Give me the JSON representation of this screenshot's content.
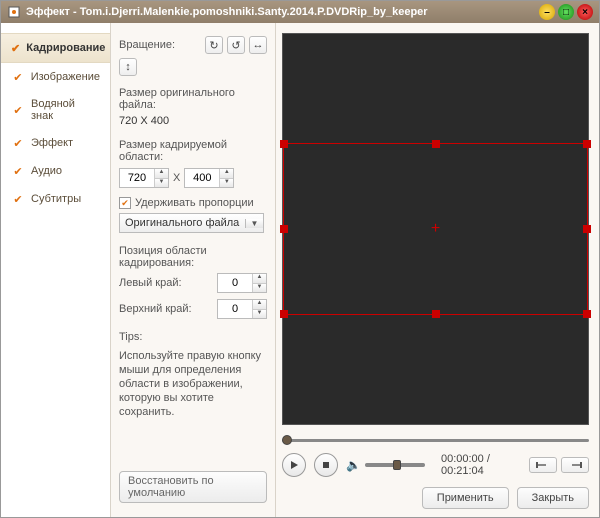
{
  "title": "Эффект - Tom.i.Djerri.Malenkie.pomoshniki.Santy.2014.P.DVDRip_by_keeper",
  "sidebar": {
    "items": [
      {
        "label": "Кадрирование",
        "active": true
      },
      {
        "label": "Изображение",
        "active": false
      },
      {
        "label": "Водяной знак",
        "active": false
      },
      {
        "label": "Эффект",
        "active": false
      },
      {
        "label": "Аудио",
        "active": false
      },
      {
        "label": "Субтитры",
        "active": false
      }
    ]
  },
  "mid": {
    "rotation_label": "Вращение:",
    "orig_size_label": "Размер оригинального файла:",
    "orig_size_value": "720 X 400",
    "crop_size_label": "Размер кадрируемой области:",
    "width": "720",
    "x_sep": "X",
    "height": "400",
    "keep_ratio": "Удерживать пропорции",
    "combo_value": "Оригинального файла",
    "pos_label": "Позиция области кадрирования:",
    "left_label": "Левый край:",
    "left_value": "0",
    "top_label": "Верхний край:",
    "top_value": "0",
    "tips_head": "Tips:",
    "tips_body": "Используйте правую кнопку мыши для определения области в изображении, которую вы хотите сохранить.",
    "restore": "Восстановить по умолчанию"
  },
  "player": {
    "time": "00:00:00 / 00:21:04"
  },
  "footer": {
    "apply": "Применить",
    "close": "Закрыть"
  }
}
